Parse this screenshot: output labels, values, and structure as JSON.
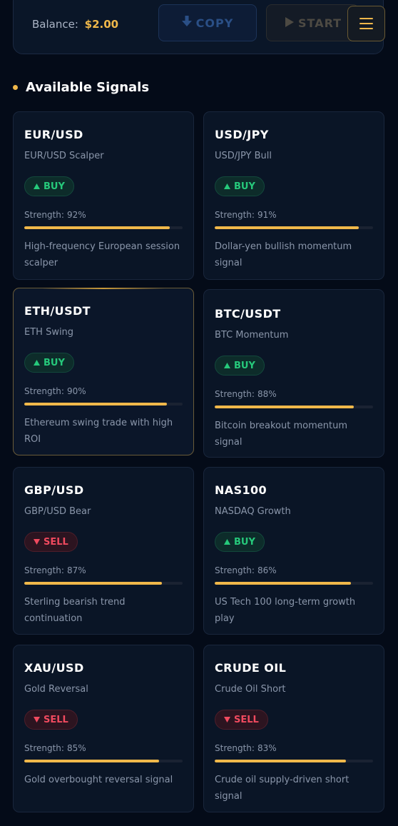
{
  "header": {
    "balance_label": "Balance:",
    "balance_value": "$2.00",
    "copy_label": "COPY",
    "start_label": "START",
    "copy_icon": "download-arrow-icon",
    "start_icon": "play-icon",
    "menu_icon": "hamburger-menu-icon"
  },
  "section": {
    "title": "Available Signals"
  },
  "colors": {
    "accent": "#f0b84a",
    "buy": "#26c97b",
    "sell": "#f04a5f",
    "background": "#040b18"
  },
  "signals": [
    {
      "pair": "EUR/USD",
      "strategy": "EUR/USD Scalper",
      "direction": "BUY",
      "strength_label": "Strength:",
      "strength": "92%",
      "strength_value": 92,
      "description": "High-frequency European session scalper"
    },
    {
      "pair": "USD/JPY",
      "strategy": "USD/JPY Bull",
      "direction": "BUY",
      "strength_label": "Strength:",
      "strength": "91%",
      "strength_value": 91,
      "description": "Dollar-yen bullish momentum signal"
    },
    {
      "pair": "ETH/USDT",
      "strategy": "ETH Swing",
      "direction": "BUY",
      "strength_label": "Strength:",
      "strength": "90%",
      "strength_value": 90,
      "description": "Ethereum swing trade with high ROI",
      "selected": true
    },
    {
      "pair": "BTC/USDT",
      "strategy": "BTC Momentum",
      "direction": "BUY",
      "strength_label": "Strength:",
      "strength": "88%",
      "strength_value": 88,
      "description": "Bitcoin breakout momentum signal"
    },
    {
      "pair": "GBP/USD",
      "strategy": "GBP/USD Bear",
      "direction": "SELL",
      "strength_label": "Strength:",
      "strength": "87%",
      "strength_value": 87,
      "description": "Sterling bearish trend continuation"
    },
    {
      "pair": "NAS100",
      "strategy": "NASDAQ Growth",
      "direction": "BUY",
      "strength_label": "Strength:",
      "strength": "86%",
      "strength_value": 86,
      "description": "US Tech 100 long-term growth play"
    },
    {
      "pair": "XAU/USD",
      "strategy": "Gold Reversal",
      "direction": "SELL",
      "strength_label": "Strength:",
      "strength": "85%",
      "strength_value": 85,
      "description": "Gold overbought reversal signal"
    },
    {
      "pair": "CRUDE OIL",
      "strategy": "Crude Oil Short",
      "direction": "SELL",
      "strength_label": "Strength:",
      "strength": "83%",
      "strength_value": 83,
      "description": "Crude oil supply-driven short signal"
    }
  ]
}
